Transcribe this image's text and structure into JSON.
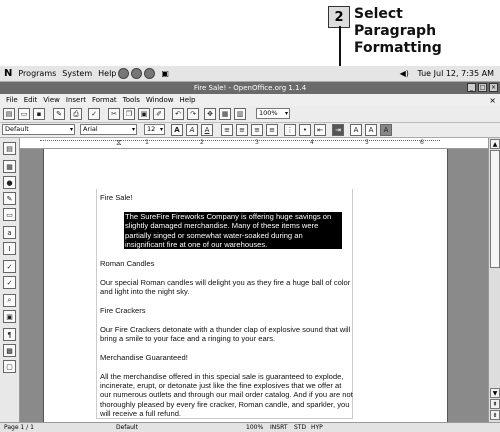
{
  "callout": {
    "number": "2",
    "text": "Select\nParagraph\nFormatting"
  },
  "system_bar": {
    "menus": [
      "Programs",
      "System",
      "Help"
    ],
    "datetime": "Tue Jul 12,  7:35 AM"
  },
  "window": {
    "title": "Fire Sale! - OpenOffice.org 1.1.4"
  },
  "menu": [
    "File",
    "Edit",
    "View",
    "Insert",
    "Format",
    "Tools",
    "Window",
    "Help"
  ],
  "toolbar": {
    "zoom": "100%"
  },
  "format_bar": {
    "style": "Default",
    "font": "Arial",
    "size": "12"
  },
  "ruler": {
    "marks": [
      "1",
      "2",
      "3",
      "4",
      "5",
      "6"
    ]
  },
  "document": {
    "paragraphs": [
      "Fire Sale!",
      "The SureFire Fireworks Company is offering huge savings on slightly damaged merchandise.  Many of these items were partially singed or somewhat water-soaked during an insignificant fire at one of our warehouses.",
      "Roman Candles",
      "Our special Roman candles will delight you as they fire a huge ball of color and light into the night sky.",
      "Fire Crackers",
      "Our Fire Crackers detonate with a thunder clap of explosive sound that will bring a smile to your face and a ringing to your ears.",
      "Merchandise Guaranteed!",
      "All the merchandise offered in this special sale is guaranteed to explode, incinerate, erupt, or detonate just like the fine explosives that we offer at our numerous outlets and through our mail order catalog.  And if you are not thoroughly pleased by every fire cracker, Roman candle, and sparkler, you will receive a full refund."
    ]
  },
  "status": {
    "page": "Page 1 / 1",
    "style": "Default",
    "zoom": "100%",
    "insert": "INSRT",
    "std": "STD",
    "hyp": "HYP"
  }
}
